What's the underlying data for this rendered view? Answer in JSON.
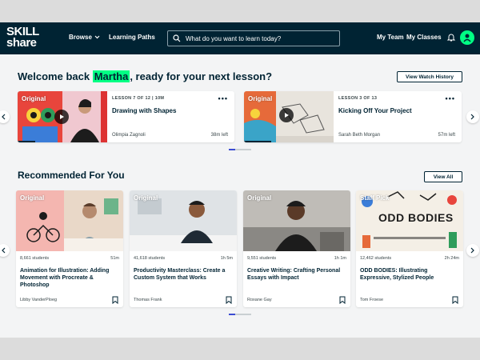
{
  "brand": {
    "logo_line1": "SKILL",
    "logo_line2": "share",
    "logo_dot": "."
  },
  "nav": {
    "browse": "Browse",
    "learning_paths": "Learning Paths",
    "search_placeholder": "What do you want to learn today?",
    "my_team": "My Team",
    "my_classes": "My Classes"
  },
  "welcome": {
    "prefix": "Welcome back ",
    "name": "Martha",
    "suffix": ", ready for your next lesson?",
    "history_button": "View Watch History"
  },
  "lessons": [
    {
      "badge": "Original",
      "meta": "LESSON 7 OF 12 | 10M",
      "title": "Drawing with Shapes",
      "author": "Olimpia Zagnoli",
      "left": "38m left",
      "progress": 0.2
    },
    {
      "badge": "Original",
      "meta": "LESSON 3 OF 13",
      "title": "Kicking Off Your Project",
      "author": "Sarah Beth Morgan",
      "left": "57m left",
      "progress": 0.3
    }
  ],
  "recommended": {
    "title": "Recommended For You",
    "view_all": "View All",
    "courses": [
      {
        "badge": "Original",
        "students": "8,661 students",
        "duration": "51m",
        "title": "Animation for Illustration: Adding Movement with Procreate & Photoshop",
        "author": "Libby VanderPloeg"
      },
      {
        "badge": "Original",
        "students": "41,618 students",
        "duration": "1h 5m",
        "title": "Productivity Masterclass: Create a Custom System that Works",
        "author": "Thomas Frank"
      },
      {
        "badge": "Original",
        "students": "9,551 students",
        "duration": "1h 1m",
        "title": "Creative Writing: Crafting Personal Essays with Impact",
        "author": "Roxane Gay"
      },
      {
        "badge": "Staff Pick",
        "students": "12,462 students",
        "duration": "2h 24m",
        "title": "ODD BODIES: Illustrating Expressive, Stylized People",
        "author": "Tom Froese",
        "thumb_text": "ODD BODIES"
      }
    ]
  },
  "colors": {
    "brand_navy": "#002333",
    "accent_green": "#00ff84",
    "pager_active": "#3b4cd2"
  },
  "icons": [
    "search-icon",
    "chevron-down-icon",
    "bell-icon",
    "play-icon",
    "more-icon",
    "arrow-left-icon",
    "arrow-right-icon",
    "bookmark-icon"
  ]
}
